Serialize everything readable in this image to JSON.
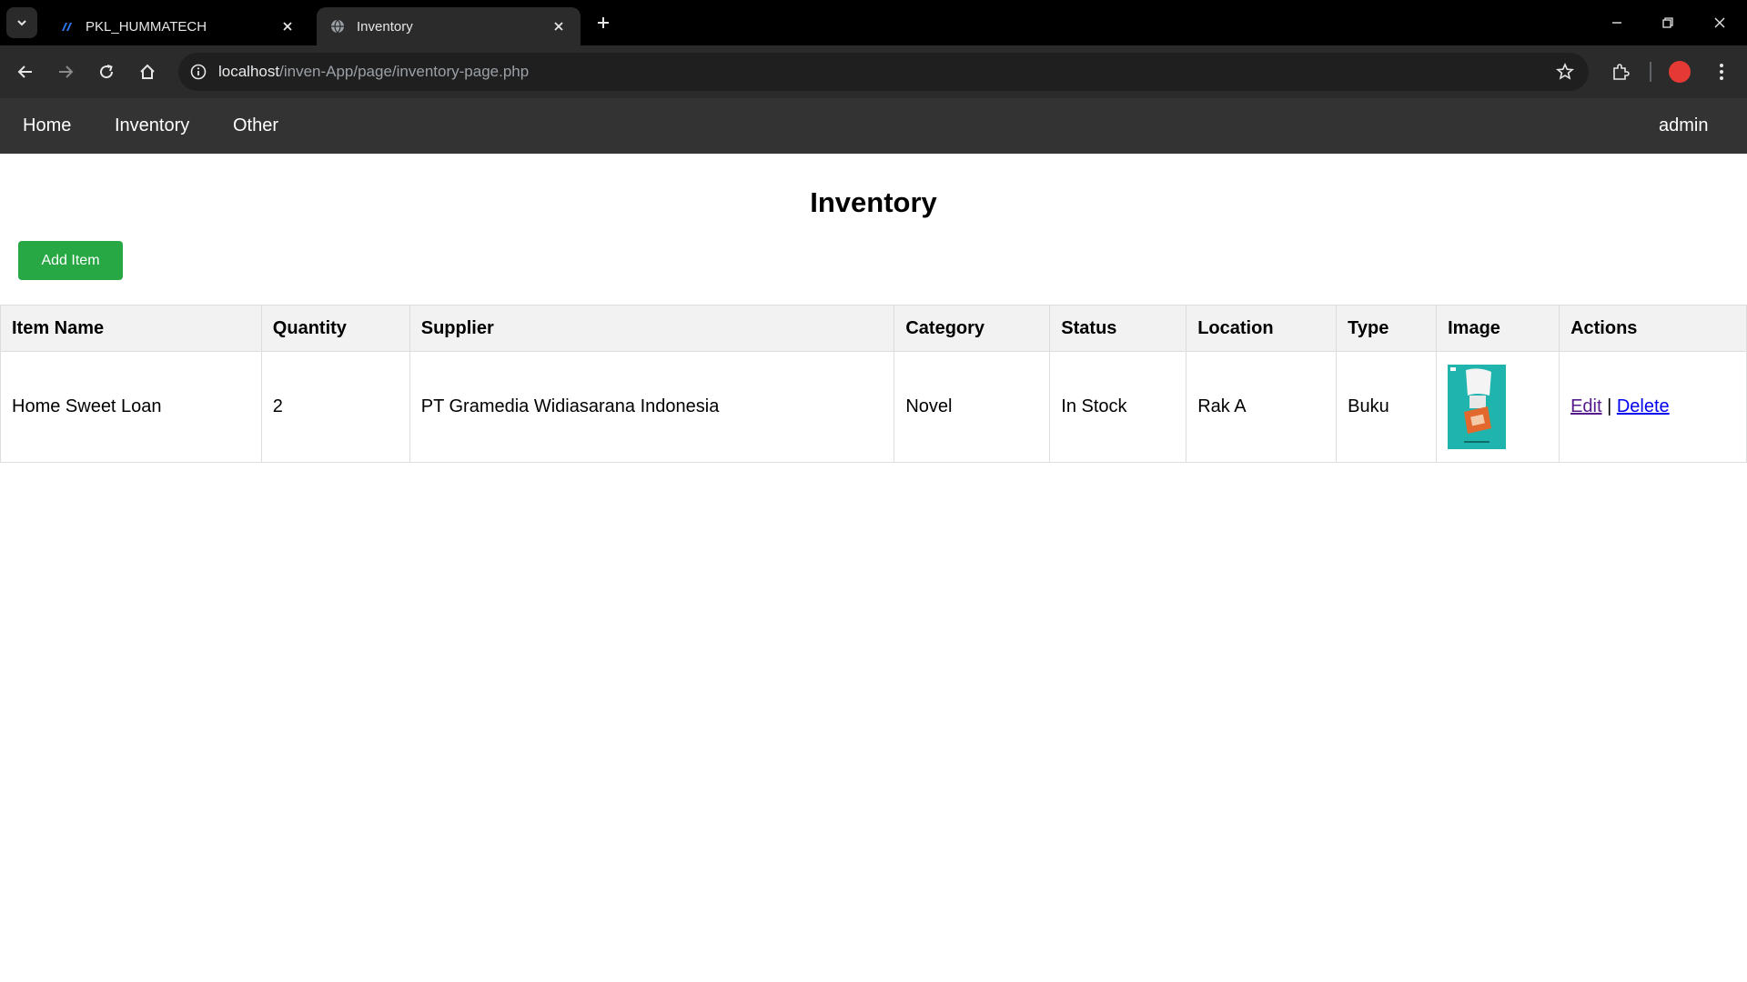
{
  "browser": {
    "tabs": [
      {
        "title": "PKL_HUMMATECH",
        "active": false
      },
      {
        "title": "Inventory",
        "active": true
      }
    ],
    "url_host": "localhost",
    "url_path": "/inven-App/page/inventory-page.php",
    "profile_color": "#e53935"
  },
  "nav": {
    "home": "Home",
    "inventory": "Inventory",
    "other": "Other",
    "user": "admin"
  },
  "page": {
    "title": "Inventory",
    "add_label": "Add Item"
  },
  "table": {
    "headers": [
      "Item Name",
      "Quantity",
      "Supplier",
      "Category",
      "Status",
      "Location",
      "Type",
      "Image",
      "Actions"
    ],
    "rows": [
      {
        "item_name": "Home Sweet Loan",
        "quantity": "2",
        "supplier": "PT Gramedia Widiasarana Indonesia",
        "category": "Novel",
        "status": "In Stock",
        "location": "Rak A",
        "type": "Buku",
        "edit": "Edit",
        "separator": "|",
        "delete": "Delete"
      }
    ]
  },
  "colors": {
    "navbar": "#333333",
    "add_button": "#28a745",
    "header_bg": "#f2f2f2"
  }
}
